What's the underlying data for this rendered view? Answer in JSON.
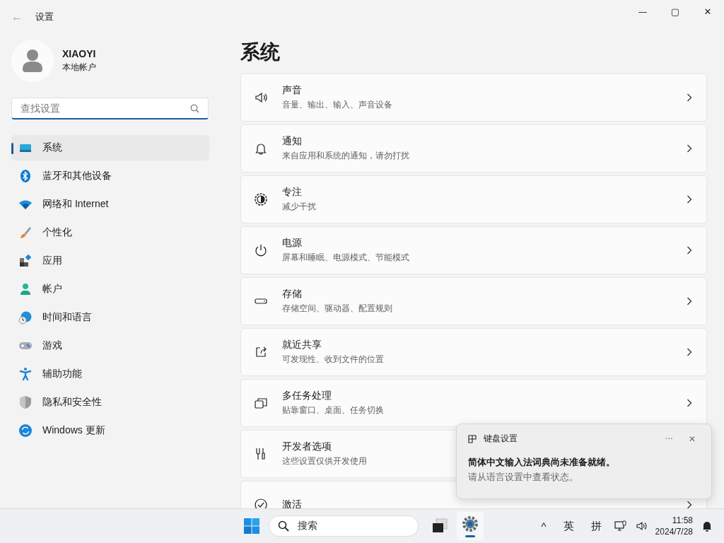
{
  "window": {
    "title": "设置",
    "back_button": "←",
    "controls": [
      "—",
      "▢",
      "✕"
    ]
  },
  "account": {
    "name": "XIAOYI",
    "type": "本地帐户"
  },
  "search": {
    "placeholder": "查找设置"
  },
  "sidebar": {
    "items": [
      {
        "label": "系统",
        "selected": true
      },
      {
        "label": "蓝牙和其他设备",
        "selected": false
      },
      {
        "label": "网络和 Internet",
        "selected": false
      },
      {
        "label": "个性化",
        "selected": false
      },
      {
        "label": "应用",
        "selected": false
      },
      {
        "label": "帐户",
        "selected": false
      },
      {
        "label": "时间和语言",
        "selected": false
      },
      {
        "label": "游戏",
        "selected": false
      },
      {
        "label": "辅助功能",
        "selected": false
      },
      {
        "label": "隐私和安全性",
        "selected": false
      },
      {
        "label": "Windows 更新",
        "selected": false
      }
    ]
  },
  "page": {
    "title": "系统",
    "cards": [
      {
        "title": "声音",
        "subtitle": "音量、输出、输入、声音设备"
      },
      {
        "title": "通知",
        "subtitle": "来自应用和系统的通知，请勿打扰"
      },
      {
        "title": "专注",
        "subtitle": "减少干扰"
      },
      {
        "title": "电源",
        "subtitle": "屏幕和睡眠、电源模式、节能模式"
      },
      {
        "title": "存储",
        "subtitle": "存储空间、驱动器、配置规则"
      },
      {
        "title": "就近共享",
        "subtitle": "可发现性、收到文件的位置"
      },
      {
        "title": "多任务处理",
        "subtitle": "贴靠窗口、桌面、任务切换"
      },
      {
        "title": "开发者选项",
        "subtitle": "这些设置仅供开发使用"
      },
      {
        "title": "激活"
      }
    ]
  },
  "notification": {
    "app": "键盘设置",
    "more": "···",
    "close": "✕",
    "message": "简体中文输入法词典尚未准备就绪。",
    "detail": "请从语言设置中查看状态。"
  },
  "taskbar": {
    "search_placeholder": "搜索",
    "tray": {
      "caret": "^",
      "language": "英",
      "ime": "拼",
      "time": "11:58",
      "date": "2024/7/28"
    }
  }
}
